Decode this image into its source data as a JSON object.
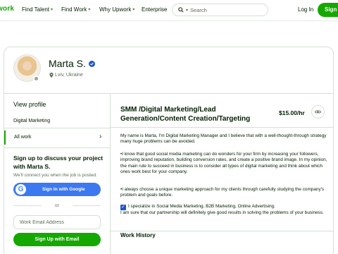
{
  "nav": {
    "logo": "work",
    "links": [
      {
        "label": "Find Talent"
      },
      {
        "label": "Find Work"
      },
      {
        "label": "Why Upwork"
      },
      {
        "label": "Enterprise"
      }
    ],
    "search_placeholder": "Search",
    "login": "Log In",
    "signup": "Sign"
  },
  "profile": {
    "name": "Marta S.",
    "location": "Lviv, Ukraine"
  },
  "left": {
    "view_profile": "View profile",
    "items": [
      {
        "label": "Digital Marketing"
      },
      {
        "label": "All work"
      }
    ],
    "cta_title": "Sign up to discuss your project with Marta S.",
    "cta_sub": "We'll connect you when the job is posted.",
    "google_button": "Sign In with Google",
    "or": "or",
    "email_placeholder": "Work Email Address",
    "signup_email": "Sign Up with Email"
  },
  "right": {
    "title": "SMM /Digital Marketing/Lead Generation/Content Creation/Targeting",
    "rate": "$15.00/hr",
    "paragraphs": [
      "My name is Marta, I'm Digital Marketing Manager and I believe that with a well-thought-through strategy many huge problems can be avoided.",
      "•I know that good social media marketing can do wonders for your firm by increasing your followers, improving brand reputation, building conversion rates, and create a positive brand image. In my opinion, the main rule to succeed in business is to consider all types of digital marketing and think about which ones work best for your company.",
      "•I always choose a unique marketing approach for my clients through carefully studying the company's problem and goals before."
    ],
    "specialize_line": "I specialize in Social Media Marketing, B2B Marketing, Online Advertising.",
    "closing_line": "I am sure that our partnership will definitely give good results in solving the problems of your business.",
    "work_history": "Work History"
  },
  "colors": {
    "brand_green": "#14a800",
    "google_blue": "#3c78f0",
    "verified_blue": "#1f57c3"
  }
}
